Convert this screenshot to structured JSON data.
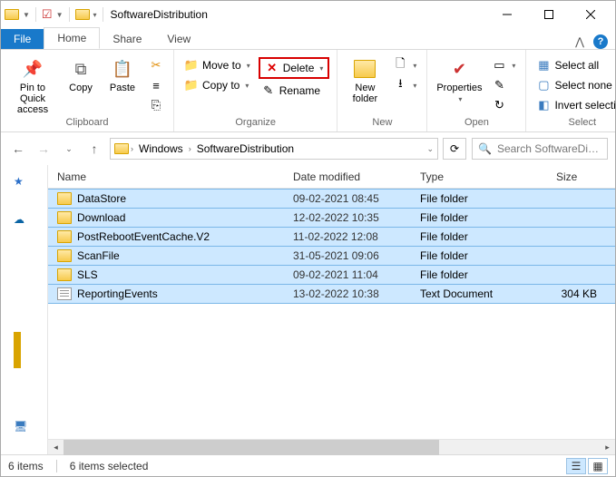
{
  "window": {
    "title": "SoftwareDistribution"
  },
  "tabs": {
    "file": "File",
    "home": "Home",
    "share": "Share",
    "view": "View"
  },
  "ribbon": {
    "clipboard": {
      "label": "Clipboard",
      "pin": "Pin to Quick access",
      "copy": "Copy",
      "paste": "Paste"
    },
    "organize": {
      "label": "Organize",
      "moveto": "Move to",
      "copyto": "Copy to",
      "delete": "Delete",
      "rename": "Rename"
    },
    "new": {
      "label": "New",
      "newfolder": "New folder"
    },
    "open": {
      "label": "Open",
      "properties": "Properties"
    },
    "select": {
      "label": "Select",
      "all": "Select all",
      "none": "Select none",
      "invert": "Invert selection"
    }
  },
  "breadcrumb": {
    "root": "Windows",
    "current": "SoftwareDistribution"
  },
  "search": {
    "placeholder": "Search SoftwareDi…"
  },
  "columns": {
    "name": "Name",
    "date": "Date modified",
    "type": "Type",
    "size": "Size"
  },
  "items": [
    {
      "name": "DataStore",
      "date": "09-02-2021 08:45",
      "type": "File folder",
      "size": "",
      "icon": "folder"
    },
    {
      "name": "Download",
      "date": "12-02-2022 10:35",
      "type": "File folder",
      "size": "",
      "icon": "folder"
    },
    {
      "name": "PostRebootEventCache.V2",
      "date": "11-02-2022 12:08",
      "type": "File folder",
      "size": "",
      "icon": "folder"
    },
    {
      "name": "ScanFile",
      "date": "31-05-2021 09:06",
      "type": "File folder",
      "size": "",
      "icon": "folder"
    },
    {
      "name": "SLS",
      "date": "09-02-2021 11:04",
      "type": "File folder",
      "size": "",
      "icon": "folder"
    },
    {
      "name": "ReportingEvents",
      "date": "13-02-2022 10:38",
      "type": "Text Document",
      "size": "304 KB",
      "icon": "txt"
    }
  ],
  "status": {
    "count": "6 items",
    "selected": "6 items selected"
  }
}
